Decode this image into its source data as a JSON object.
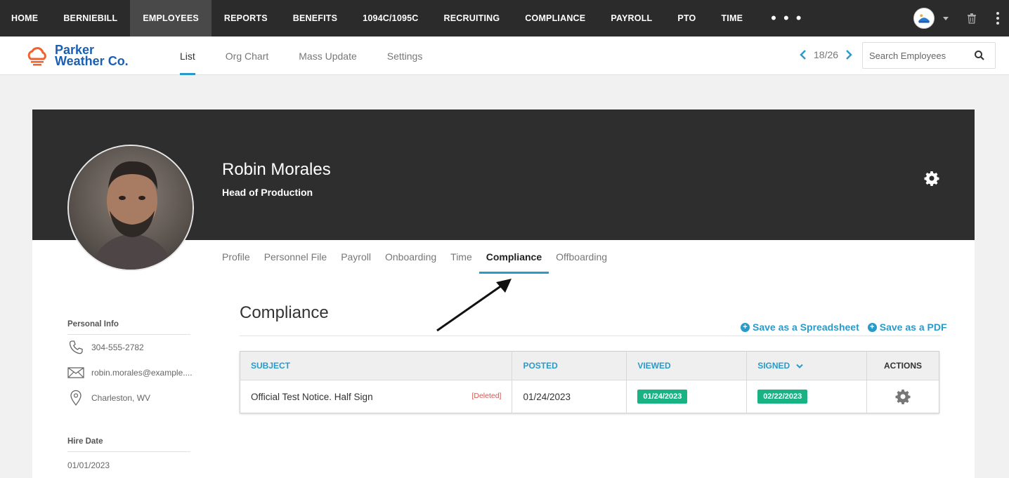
{
  "topnav": {
    "items": [
      "HOME",
      "BERNIEBILL",
      "EMPLOYEES",
      "REPORTS",
      "BENEFITS",
      "1094C/1095C",
      "RECRUITING",
      "COMPLIANCE",
      "PAYROLL",
      "PTO",
      "TIME"
    ],
    "active_index": 2,
    "more_label": "• • •",
    "icons": [
      "user-avatar",
      "chevron-down-icon",
      "trash-icon",
      "kebab-menu-icon"
    ]
  },
  "subheader": {
    "logo": {
      "line1": "Parker",
      "line2": "Weather Co."
    },
    "tabs": [
      "List",
      "Org Chart",
      "Mass Update",
      "Settings"
    ],
    "active_tab": "List",
    "pager": {
      "text": "18/26"
    },
    "search": {
      "placeholder": "Search Employees",
      "value": ""
    }
  },
  "employee": {
    "name": "Robin Morales",
    "title": "Head of Production"
  },
  "profile_tabs": [
    "Profile",
    "Personnel File",
    "Payroll",
    "Onboarding",
    "Time",
    "Compliance",
    "Offboarding"
  ],
  "active_profile_tab": "Compliance",
  "sidebar": {
    "personal_info_label": "Personal Info",
    "phone": "304-555-2782",
    "email": "robin.morales@example....",
    "location": "Charleston, WV",
    "hire_date_label": "Hire Date",
    "hire_date": "01/01/2023"
  },
  "compliance": {
    "title": "Compliance",
    "save_spreadsheet": "Save as a Spreadsheet",
    "save_pdf": "Save as a PDF",
    "columns": {
      "subject": "SUBJECT",
      "posted": "POSTED",
      "viewed": "VIEWED",
      "signed": "SIGNED",
      "actions": "ACTIONS"
    },
    "rows": [
      {
        "subject": "Official Test Notice. Half Sign",
        "status": "[Deleted]",
        "posted": "01/24/2023",
        "viewed": "01/24/2023",
        "signed": "02/22/2023"
      }
    ]
  },
  "colors": {
    "accent": "#2a9bc9",
    "nav_bg": "#2b2b2b",
    "badge_green": "#19b383",
    "deleted_red": "#d9534f"
  }
}
